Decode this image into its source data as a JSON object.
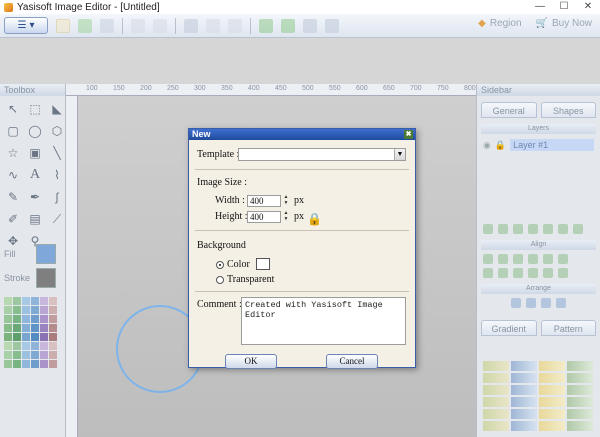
{
  "window": {
    "title": "Yasisoft Image Editor - [Untitled]",
    "min": "—",
    "max": "☐",
    "close": "✕"
  },
  "toolbar": {
    "region_label": "Region",
    "buy_label": "Buy Now"
  },
  "left_panel": {
    "title": "Toolbox",
    "fill_label": "Fill",
    "stroke_label": "Stroke",
    "fill_color": "#7fa7d9",
    "stroke_color": "#7f7f7f"
  },
  "ruler": {
    "ticks": [
      "100",
      "150",
      "200",
      "250",
      "300",
      "350",
      "400",
      "450",
      "500",
      "550",
      "600",
      "650",
      "700",
      "750",
      "800"
    ]
  },
  "right_panel": {
    "title": "Sidebar",
    "tabs": [
      "General",
      "Shapes"
    ],
    "layers_header": "Layers",
    "layer_name": "Layer #1",
    "align_header": "Align",
    "arrange_header": "Arrange",
    "bottom_tabs": [
      "Gradient",
      "Pattern"
    ]
  },
  "dialog": {
    "title": "New",
    "template_label": "Template :",
    "template_value": "",
    "image_size_label": "Image Size :",
    "width_label": "Width :",
    "width_value": "400",
    "height_label": "Height :",
    "height_value": "400",
    "unit": "px",
    "background_label": "Background",
    "color_option": "Color",
    "transparent_option": "Transparent",
    "comment_label": "Comment :",
    "comment_value": "Created with Yasisoft Image Editor",
    "ok_label": "OK",
    "cancel_label": "Cancel",
    "selected_background": "Color"
  }
}
